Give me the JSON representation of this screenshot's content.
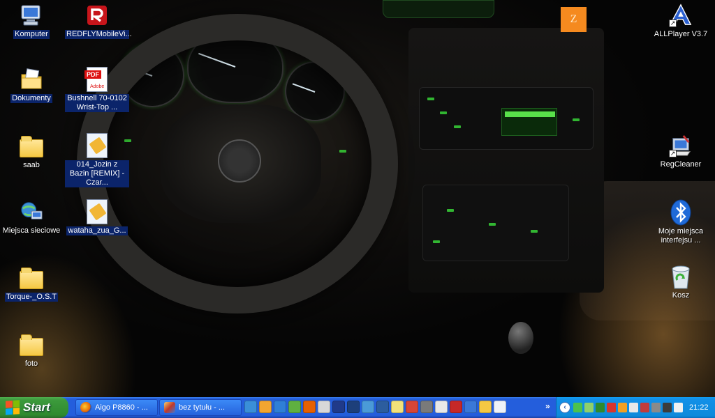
{
  "desktop": {
    "icons": [
      {
        "label": "Komputer",
        "icon": "my-computer-icon"
      },
      {
        "label": "REDFLYMobileVi...",
        "icon": "redfly-app-icon"
      },
      {
        "label": "Dokumenty",
        "icon": "my-documents-icon"
      },
      {
        "label": "Bushnell 70-0102 Wrist-Top ...",
        "icon": "pdf-file-icon",
        "pdf_tag": "PDF",
        "pdf_brand": "Adobe"
      },
      {
        "label": "saab",
        "icon": "folder-icon"
      },
      {
        "label": "014_Jozin z Bazin [REMIX] - Czar...",
        "icon": "audio-file-icon"
      },
      {
        "label": "Miejsca sieciowe",
        "icon": "network-places-icon"
      },
      {
        "label": "wataha_zua_G...",
        "icon": "audio-file-icon"
      },
      {
        "label": "Torque-_O.S.T",
        "icon": "folder-icon"
      },
      {
        "label": "foto",
        "icon": "folder-icon"
      },
      {
        "label": "ALLPlayer V3.7",
        "icon": "allplayer-icon"
      },
      {
        "label": "RegCleaner",
        "icon": "regcleaner-icon"
      },
      {
        "label": "Moje miejsca interfejsu ...",
        "icon": "bluetooth-icon"
      },
      {
        "label": "Kosz",
        "icon": "recycle-bin-icon"
      }
    ],
    "orange_tile_letter": "Z"
  },
  "taskbar": {
    "start_label": "Start",
    "tasks": [
      {
        "label": "Aigo P8860 - ...",
        "icon": "firefox-icon"
      },
      {
        "label": "bez tytułu - ...",
        "icon": "paint-icon"
      }
    ],
    "quick_launch": [
      "quicktime-icon",
      "winamp-icon",
      "ie-icon",
      "media-icon",
      "firefox-icon",
      "keyboard-icon",
      "a-icon",
      "save-icon",
      "globe-icon",
      "screen-icon",
      "bulb-icon",
      "chrome-icon",
      "rocket-icon",
      "vp-icon",
      "opera-icon",
      "flash-icon",
      "folder-icon",
      "doc-icon"
    ],
    "tray": {
      "overflow_glyph": "‹",
      "icons": [
        "signal-icon",
        "network-icon",
        "tree-icon",
        "virus-icon",
        "sun-icon",
        "mouse-icon",
        "shield-icon",
        "gear-icon",
        "display-icon",
        "vp-icon"
      ],
      "clock": "21:22"
    },
    "chevron": "»"
  },
  "colors": {
    "taskbar_blue": "#245edc",
    "start_green": "#3c9a3c",
    "tray_blue": "#0d8adb",
    "label_highlight": "#0b246a"
  }
}
